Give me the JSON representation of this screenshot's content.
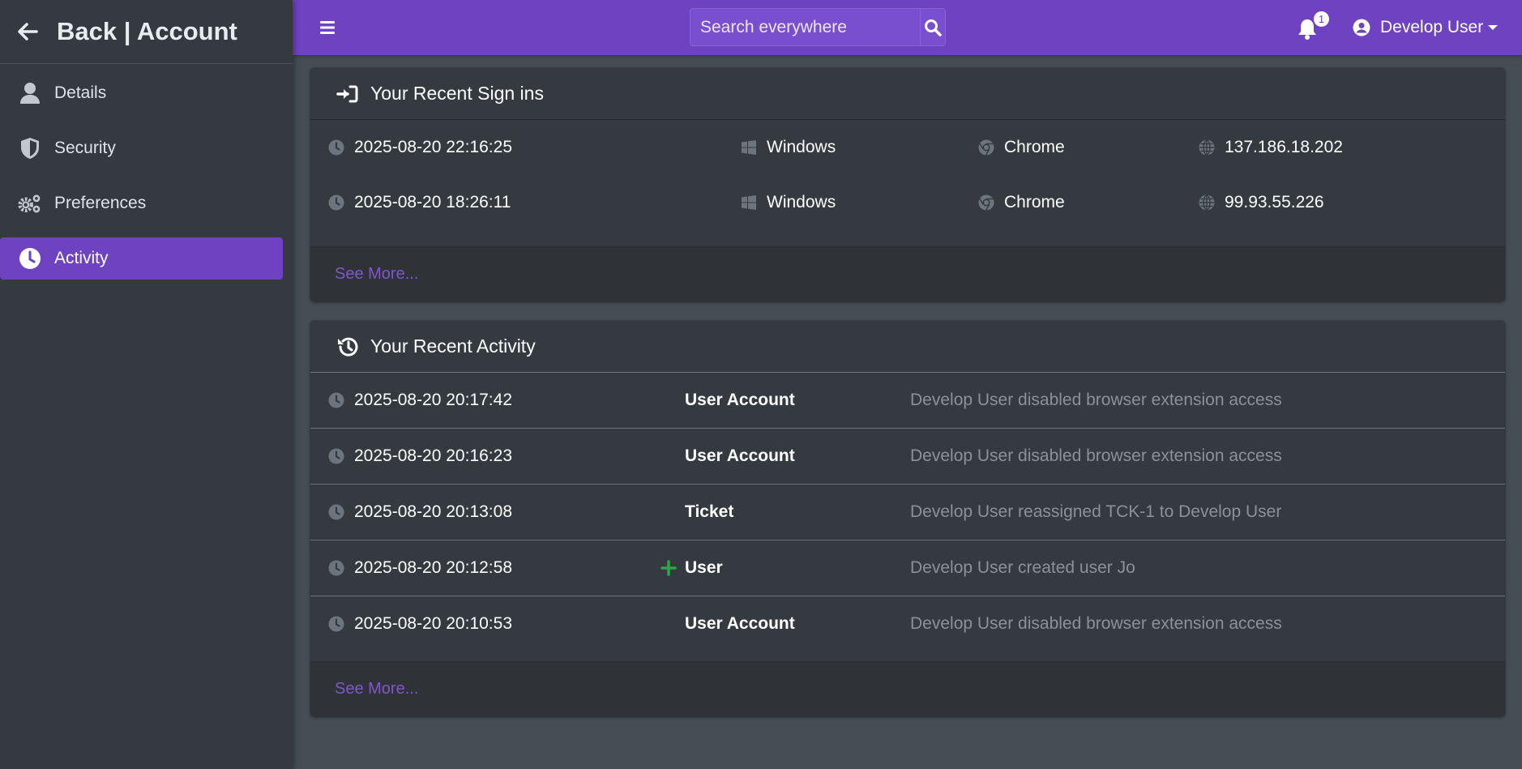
{
  "sidebar": {
    "brand": "Back | Account",
    "items": [
      {
        "label": "Details",
        "icon": "user-icon"
      },
      {
        "label": "Security",
        "icon": "shield-icon"
      },
      {
        "label": "Preferences",
        "icon": "gears-icon"
      },
      {
        "label": "Activity",
        "icon": "clock-icon",
        "active": true
      }
    ]
  },
  "topbar": {
    "search_placeholder": "Search everywhere",
    "notification_count": "1",
    "user_name": "Develop User"
  },
  "signins": {
    "title": "Your Recent Sign ins",
    "rows": [
      {
        "time": "2025-08-20 22:16:25",
        "os": "Windows",
        "browser": "Chrome",
        "ip": "137.186.18.202"
      },
      {
        "time": "2025-08-20 18:26:11",
        "os": "Windows",
        "browser": "Chrome",
        "ip": "99.93.55.226"
      }
    ],
    "see_more": "See More..."
  },
  "activity": {
    "title": "Your Recent Activity",
    "rows": [
      {
        "time": "2025-08-20 20:17:42",
        "category": "User Account",
        "description": "Develop User disabled browser extension access",
        "plus": false
      },
      {
        "time": "2025-08-20 20:16:23",
        "category": "User Account",
        "description": "Develop User disabled browser extension access",
        "plus": false
      },
      {
        "time": "2025-08-20 20:13:08",
        "category": "Ticket",
        "description": "Develop User reassigned TCK-1 to Develop User",
        "plus": false
      },
      {
        "time": "2025-08-20 20:12:58",
        "category": "User",
        "description": "Develop User created user Jo",
        "plus": true
      },
      {
        "time": "2025-08-20 20:10:53",
        "category": "User Account",
        "description": "Develop User disabled browser extension access",
        "plus": false
      }
    ],
    "see_more": "See More..."
  },
  "colors": {
    "accent": "#6f42c1",
    "sidebar_bg": "#343a40",
    "content_bg": "#454d55",
    "plus_green": "#28a745"
  }
}
